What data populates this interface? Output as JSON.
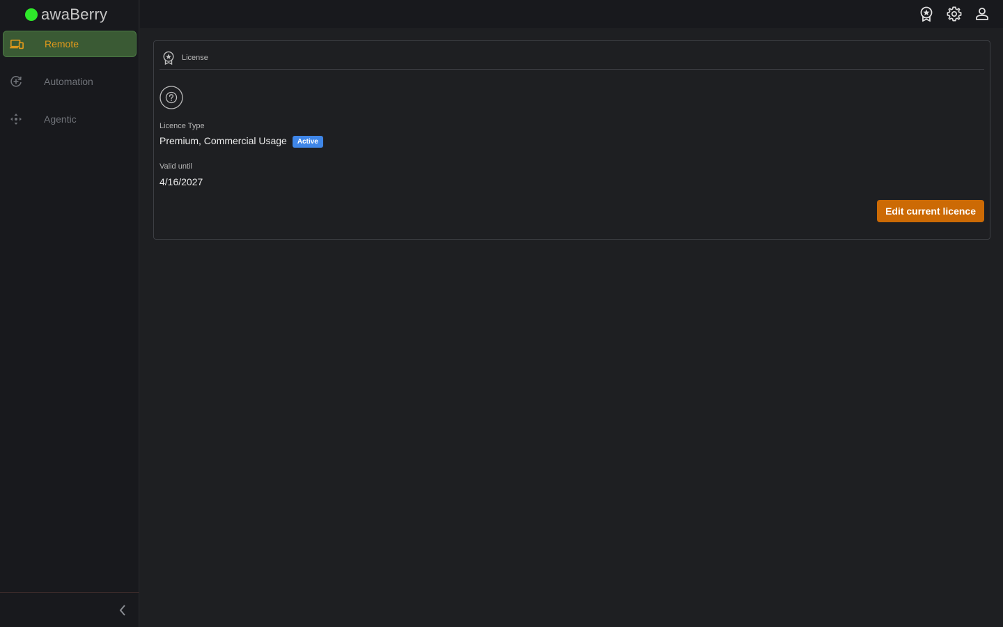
{
  "brand": {
    "name": "awaBerry",
    "dot_color": "#2ee82a"
  },
  "sidebar": {
    "items": [
      {
        "label": "Remote",
        "icon": "devices-icon",
        "active": true
      },
      {
        "label": "Automation",
        "icon": "automation-icon",
        "active": false
      },
      {
        "label": "Agentic",
        "icon": "agentic-icon",
        "active": false
      }
    ],
    "collapse_icon": "chevron-left-icon"
  },
  "topbar": {
    "icons": [
      "license-award-icon",
      "gear-icon",
      "user-icon"
    ]
  },
  "license_card": {
    "title": "License",
    "header_icon": "license-award-icon",
    "help_icon": "help-circle-icon",
    "licence_type_label": "Licence Type",
    "licence_type_value": "Premium, Commercial Usage",
    "status_badge": "Active",
    "valid_until_label": "Valid until",
    "valid_until_value": "4/16/2027",
    "edit_button_label": "Edit current licence"
  },
  "colors": {
    "accent_orange": "#cc6a05",
    "active_nav_bg": "#3a5a34",
    "active_nav_text": "#e39a1b",
    "badge_blue": "#3f86e8"
  }
}
